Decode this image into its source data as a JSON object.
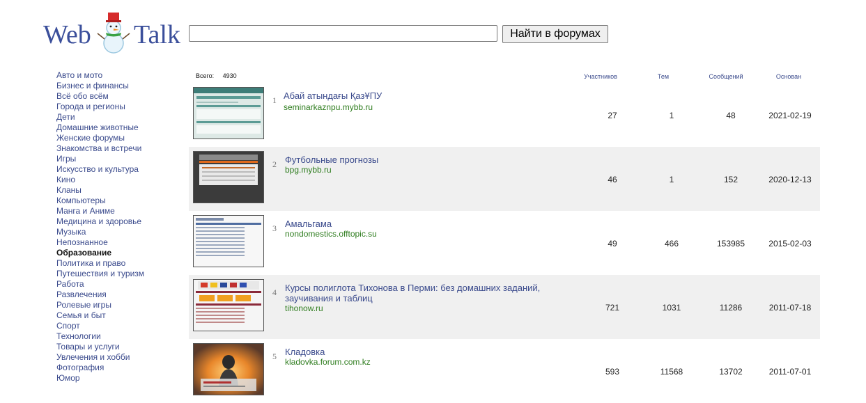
{
  "header": {
    "logo_left": "Web",
    "logo_right": "Talk",
    "search_value": "",
    "search_button": "Найти в форумах"
  },
  "sidebar": {
    "items": [
      {
        "label": "Авто и мото"
      },
      {
        "label": "Бизнес и финансы"
      },
      {
        "label": "Всё обо всём"
      },
      {
        "label": "Города и регионы"
      },
      {
        "label": "Дети"
      },
      {
        "label": "Домашние животные"
      },
      {
        "label": "Женские форумы"
      },
      {
        "label": "Знакомства и встречи"
      },
      {
        "label": "Игры"
      },
      {
        "label": "Искусство и культура"
      },
      {
        "label": "Кино"
      },
      {
        "label": "Кланы"
      },
      {
        "label": "Компьютеры"
      },
      {
        "label": "Манга и Аниме"
      },
      {
        "label": "Медицина и здоровье"
      },
      {
        "label": "Музыка"
      },
      {
        "label": "Непознанное"
      },
      {
        "label": "Образование",
        "active": true
      },
      {
        "label": "Политика и право"
      },
      {
        "label": "Путешествия и туризм"
      },
      {
        "label": "Работа"
      },
      {
        "label": "Развлечения"
      },
      {
        "label": "Ролевые игры"
      },
      {
        "label": "Семья и быт"
      },
      {
        "label": "Спорт"
      },
      {
        "label": "Технологии"
      },
      {
        "label": "Товары и услуги"
      },
      {
        "label": "Увлечения и хобби"
      },
      {
        "label": "Фотография"
      },
      {
        "label": "Юмор"
      }
    ]
  },
  "table": {
    "total_label": "Всего:",
    "total_value": "4930",
    "columns": {
      "members": "Участников",
      "topics": "Тем",
      "messages": "Сообщений",
      "founded": "Основан"
    },
    "rows": [
      {
        "num": "1",
        "title": "Абай атындағы ҚазҰПУ",
        "domain": "seminarkaznpu.mybb.ru",
        "members": "27",
        "topics": "1",
        "messages": "48",
        "founded": "2021-02-19"
      },
      {
        "num": "2",
        "title": "Футбольные прогнозы",
        "domain": "bpg.mybb.ru",
        "members": "46",
        "topics": "1",
        "messages": "152",
        "founded": "2020-12-13"
      },
      {
        "num": "3",
        "title": "Амальгама",
        "domain": "nondomestics.offtopic.su",
        "members": "49",
        "topics": "466",
        "messages": "153985",
        "founded": "2015-02-03"
      },
      {
        "num": "4",
        "title": "Курсы полиглота Тихонова в Перми: без домашних заданий, заучивания и таблиц",
        "domain": "tihonow.ru",
        "members": "721",
        "topics": "1031",
        "messages": "11286",
        "founded": "2011-07-18"
      },
      {
        "num": "5",
        "title": "Кладовка",
        "domain": "kladovka.forum.com.kz",
        "members": "593",
        "topics": "11568",
        "messages": "13702",
        "founded": "2011-07-01"
      }
    ]
  }
}
